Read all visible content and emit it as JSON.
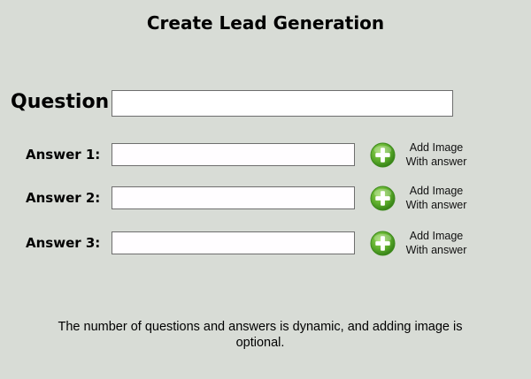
{
  "page": {
    "title": "Create Lead Generation",
    "background_color": "#d8dcd6"
  },
  "question": {
    "label": "Question",
    "value": ""
  },
  "answers": [
    {
      "label": "Answer 1:",
      "value": "",
      "add_image": {
        "line1": "Add Image",
        "line2": "With answer",
        "icon": "plus-circle-icon"
      }
    },
    {
      "label": "Answer 2:",
      "value": "",
      "add_image": {
        "line1": "Add Image",
        "line2": "With answer",
        "icon": "plus-circle-icon"
      }
    },
    {
      "label": "Answer 3:",
      "value": "",
      "add_image": {
        "line1": "Add Image",
        "line2": "With answer",
        "icon": "plus-circle-icon"
      }
    }
  ],
  "footnote": {
    "text": "The number of questions and answers is dynamic, and adding image is optional."
  },
  "colors": {
    "accent_green": "#5aaa2a",
    "input_border": "#6e6e6e"
  }
}
